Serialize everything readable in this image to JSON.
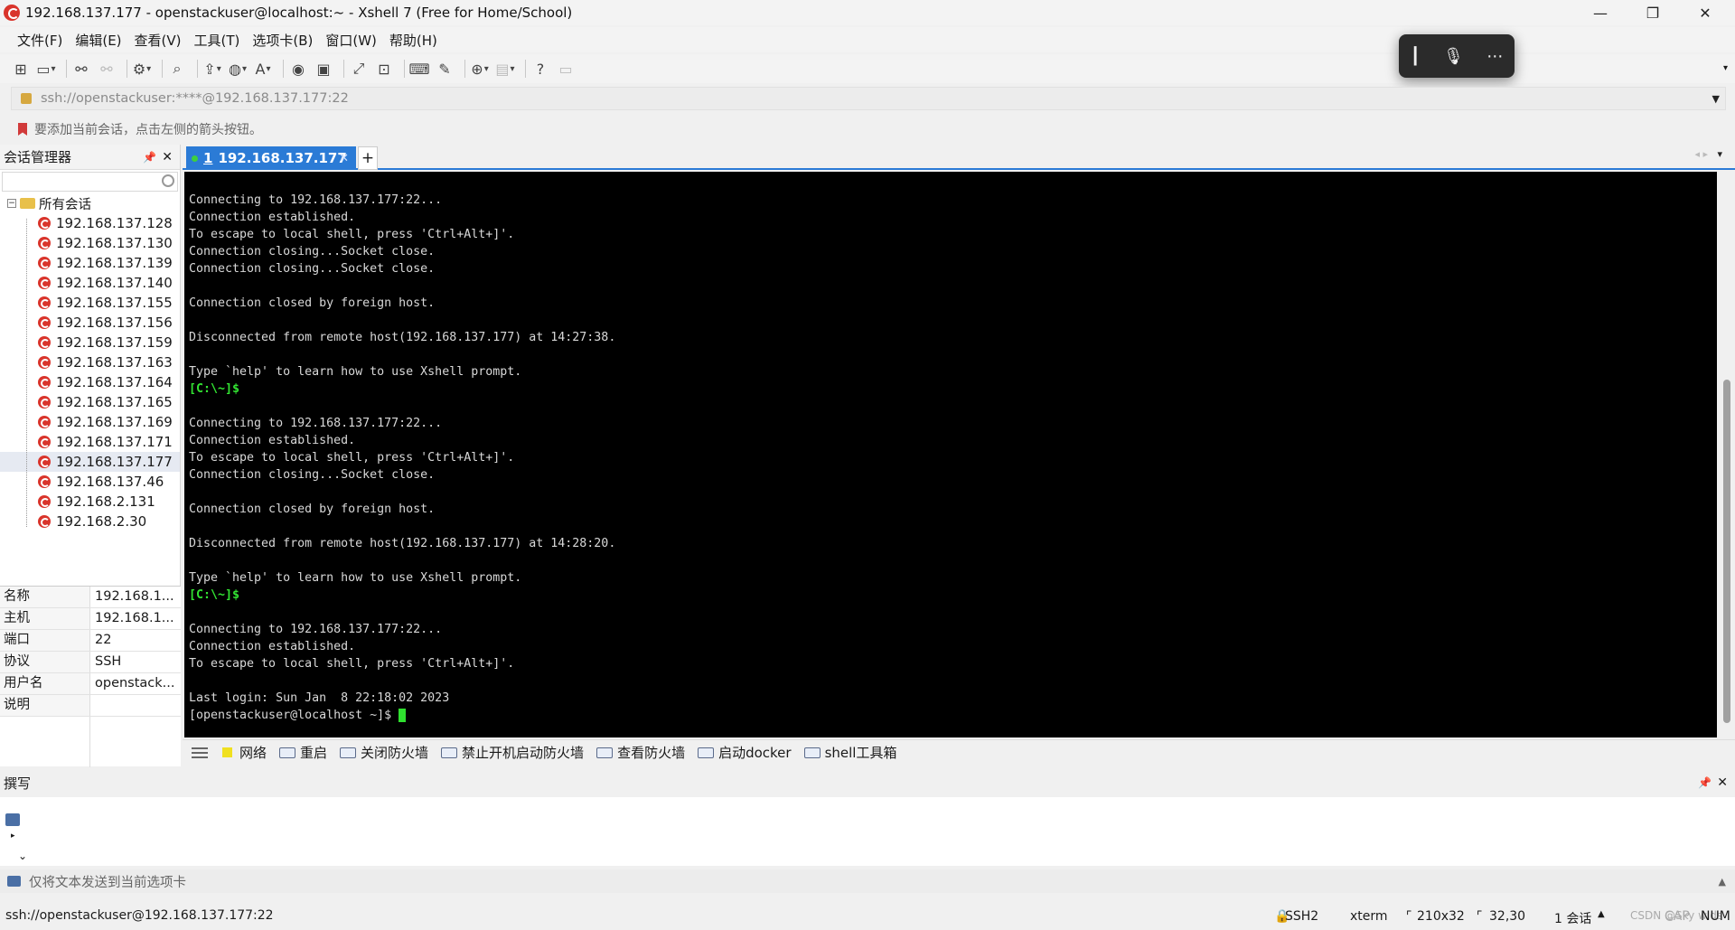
{
  "window": {
    "title": "192.168.137.177 - openstackuser@localhost:~ - Xshell 7 (Free for Home/School)"
  },
  "menu": [
    "文件(F)",
    "编辑(E)",
    "查看(V)",
    "工具(T)",
    "选项卡(B)",
    "窗口(W)",
    "帮助(H)"
  ],
  "address": {
    "value": "ssh://openstackuser:****@192.168.137.177:22"
  },
  "hint": "要添加当前会话，点击左侧的箭头按钮。",
  "sidebar": {
    "title": "会话管理器",
    "root": "所有会话",
    "sessions": [
      "192.168.137.128",
      "192.168.137.130",
      "192.168.137.139",
      "192.168.137.140",
      "192.168.137.155",
      "192.168.137.156",
      "192.168.137.159",
      "192.168.137.163",
      "192.168.137.164",
      "192.168.137.165",
      "192.168.137.169",
      "192.168.137.171",
      "192.168.137.177",
      "192.168.137.46",
      "192.168.2.131",
      "192.168.2.30"
    ],
    "selected_index": 12
  },
  "props": [
    {
      "k": "名称",
      "v": "192.168.1..."
    },
    {
      "k": "主机",
      "v": "192.168.1..."
    },
    {
      "k": "端口",
      "v": "22"
    },
    {
      "k": "协议",
      "v": "SSH"
    },
    {
      "k": "用户名",
      "v": "openstack..."
    },
    {
      "k": "说明",
      "v": ""
    }
  ],
  "tab": {
    "index": "1",
    "label": "192.168.137.177"
  },
  "terminal": {
    "lines": [
      {
        "t": "Connecting to 192.168.137.177:22..."
      },
      {
        "t": "Connection established."
      },
      {
        "t": "To escape to local shell, press 'Ctrl+Alt+]'."
      },
      {
        "t": "Connection closing...Socket close."
      },
      {
        "t": "Connection closing...Socket close."
      },
      {
        "t": ""
      },
      {
        "t": "Connection closed by foreign host."
      },
      {
        "t": ""
      },
      {
        "t": "Disconnected from remote host(192.168.137.177) at 14:27:38."
      },
      {
        "t": ""
      },
      {
        "t": "Type `help' to learn how to use Xshell prompt."
      },
      {
        "t": "[C:\\~]$",
        "g": true
      },
      {
        "t": ""
      },
      {
        "t": "Connecting to 192.168.137.177:22..."
      },
      {
        "t": "Connection established."
      },
      {
        "t": "To escape to local shell, press 'Ctrl+Alt+]'."
      },
      {
        "t": "Connection closing...Socket close."
      },
      {
        "t": ""
      },
      {
        "t": "Connection closed by foreign host."
      },
      {
        "t": ""
      },
      {
        "t": "Disconnected from remote host(192.168.137.177) at 14:28:20."
      },
      {
        "t": ""
      },
      {
        "t": "Type `help' to learn how to use Xshell prompt."
      },
      {
        "t": "[C:\\~]$",
        "g": true
      },
      {
        "t": ""
      },
      {
        "t": "Connecting to 192.168.137.177:22..."
      },
      {
        "t": "Connection established."
      },
      {
        "t": "To escape to local shell, press 'Ctrl+Alt+]'."
      },
      {
        "t": ""
      },
      {
        "t": "Last login: Sun Jan  8 22:18:02 2023"
      },
      {
        "t": "[openstackuser@localhost ~]$ ",
        "cursor": true
      }
    ]
  },
  "quickbar": [
    "网络",
    "重启",
    "关闭防火墙",
    "禁止开机启动防火墙",
    "查看防火墙",
    "启动docker",
    "shell工具箱"
  ],
  "composer": {
    "title": "撰写"
  },
  "sendbar": {
    "placeholder": "仅将文本发送到当前选项卡"
  },
  "status": {
    "left": "ssh://openstackuser@192.168.137.177:22",
    "protocol": "SSH2",
    "term": "xterm",
    "size": "210x32",
    "pos": "32,30",
    "sessions": "1 会话",
    "cap": "CAP",
    "num": "NUM",
    "watermark": "CSDN @Sky wlds"
  }
}
